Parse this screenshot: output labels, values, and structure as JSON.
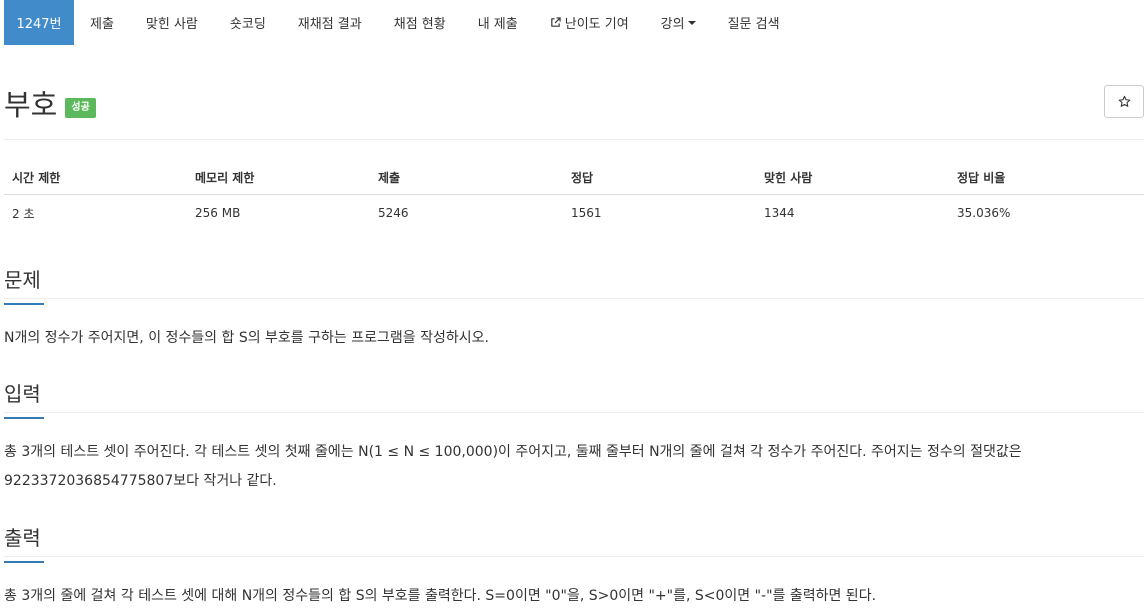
{
  "nav": {
    "active": "1247번",
    "submit": "제출",
    "solved": "맞힌 사람",
    "shortcoding": "숏코딩",
    "rejudge": "재채점 결과",
    "status": "채점 현황",
    "my_submit": "내 제출",
    "difficulty": "난이도 기여",
    "lecture": "강의",
    "qna": "질문 검색"
  },
  "problem": {
    "title": "부호",
    "badge": "성공"
  },
  "info": {
    "headers": [
      "시간 제한",
      "메모리 제한",
      "제출",
      "정답",
      "맞힌 사람",
      "정답 비율"
    ],
    "values": [
      "2 초",
      "256 MB",
      "5246",
      "1561",
      "1344",
      "35.036%"
    ]
  },
  "sections": {
    "problem_title": "문제",
    "problem_text": "N개의 정수가 주어지면, 이 정수들의 합 S의 부호를 구하는 프로그램을 작성하시오.",
    "input_title": "입력",
    "input_text": "총 3개의 테스트 셋이 주어진다. 각 테스트 셋의 첫째 줄에는 N(1 ≤ N ≤ 100,000)이 주어지고, 둘째 줄부터 N개의 줄에 걸쳐 각 정수가 주어진다. 주어지는 정수의 절댓값은 9223372036854775807보다 작거나 같다.",
    "output_title": "출력",
    "output_text": "총 3개의 줄에 걸쳐 각 테스트 셋에 대해 N개의 정수들의 합 S의 부호를 출력한다. S=0이면 \"0\"을, S>0이면 \"+\"를, S<0이면 \"-\"를 출력하면 된다."
  }
}
